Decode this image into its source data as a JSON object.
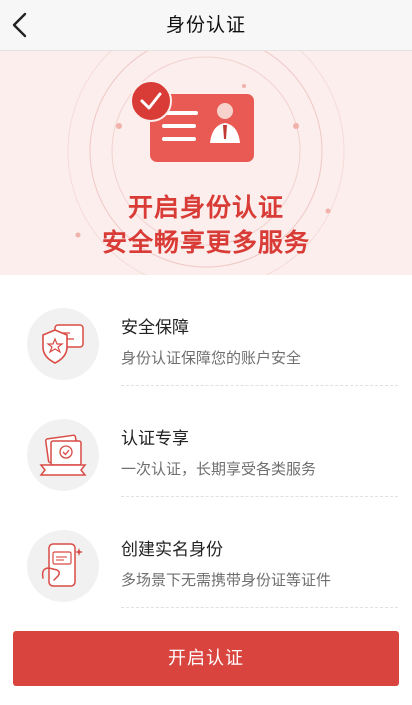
{
  "header": {
    "back_icon": "chevron-left-icon",
    "title": "身份认证"
  },
  "hero": {
    "illustration": "id-card-verified-illustration",
    "line1": "开启身份认证",
    "line2": "安全畅享更多服务",
    "accent_color": "#d93b36",
    "background_color": "#fbeeec"
  },
  "features": [
    {
      "icon": "shield-id-card-icon",
      "title": "安全保障",
      "desc": "身份认证保障您的账户安全"
    },
    {
      "icon": "certificate-ribbon-icon",
      "title": "认证专享",
      "desc": "一次认证，长期享受各类服务"
    },
    {
      "icon": "phone-id-card-icon",
      "title": "创建实名身份",
      "desc": "多场景下无需携带身份证等证件"
    }
  ],
  "action": {
    "button_label": "开启认证",
    "button_color": "#d9443e"
  }
}
